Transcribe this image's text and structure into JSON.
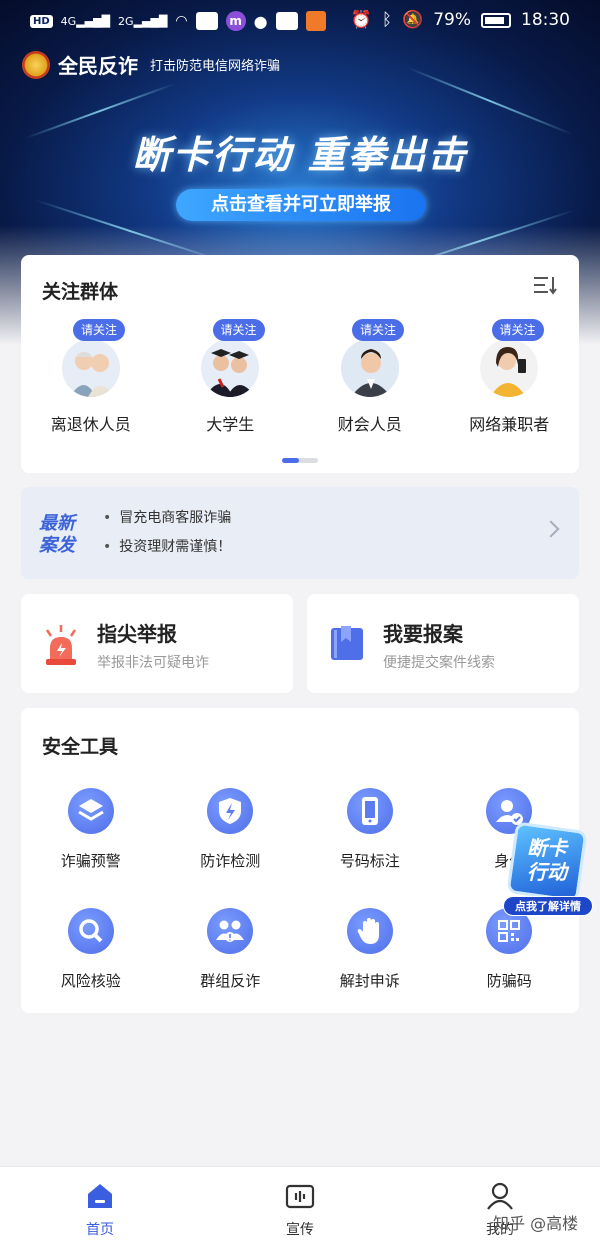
{
  "status_bar": {
    "network_1": "HD",
    "sig_1": "4G",
    "sig_2": "2G",
    "battery": "79%",
    "time": "18:30"
  },
  "header": {
    "app_name": "全民反诈",
    "slogan": "打击防范电信网络诈骗"
  },
  "banner": {
    "headline": "断卡行动 重拳出击",
    "cta": "点击查看并可立即举报"
  },
  "focus_groups": {
    "title": "关注群体",
    "follow_label": "请关注",
    "items": [
      {
        "label": "离退休人员"
      },
      {
        "label": "大学生"
      },
      {
        "label": "财会人员"
      },
      {
        "label": "网络兼职者"
      }
    ]
  },
  "news": {
    "badge_line1": "最新",
    "badge_line2": "案发",
    "items": [
      "冒充电商客服诈骗",
      "投资理财需谨慎！"
    ]
  },
  "actions": [
    {
      "title": "指尖举报",
      "subtitle": "举报非法可疑电诈"
    },
    {
      "title": "我要报案",
      "subtitle": "便捷提交案件线索"
    }
  ],
  "tools": {
    "title": "安全工具",
    "items": [
      {
        "label": "诈骗预警",
        "icon": "layers-icon"
      },
      {
        "label": "防诈检测",
        "icon": "shield-icon"
      },
      {
        "label": "号码标注",
        "icon": "phone-icon"
      },
      {
        "label": "身份",
        "icon": "user-check-icon"
      },
      {
        "label": "风险核验",
        "icon": "search-icon"
      },
      {
        "label": "群组反诈",
        "icon": "group-icon"
      },
      {
        "label": "解封申诉",
        "icon": "hand-icon"
      },
      {
        "label": "防骗码",
        "icon": "qrcode-icon"
      }
    ]
  },
  "floating_badge": {
    "line1": "断卡",
    "line2": "行动",
    "pill": "点我了解详情"
  },
  "tabbar": {
    "items": [
      {
        "label": "首页"
      },
      {
        "label": "宣传"
      },
      {
        "label": "我的"
      }
    ]
  },
  "watermark": "知乎 @高楼",
  "colors": {
    "accent": "#4b6ee8",
    "background": "#f3f3f5"
  }
}
